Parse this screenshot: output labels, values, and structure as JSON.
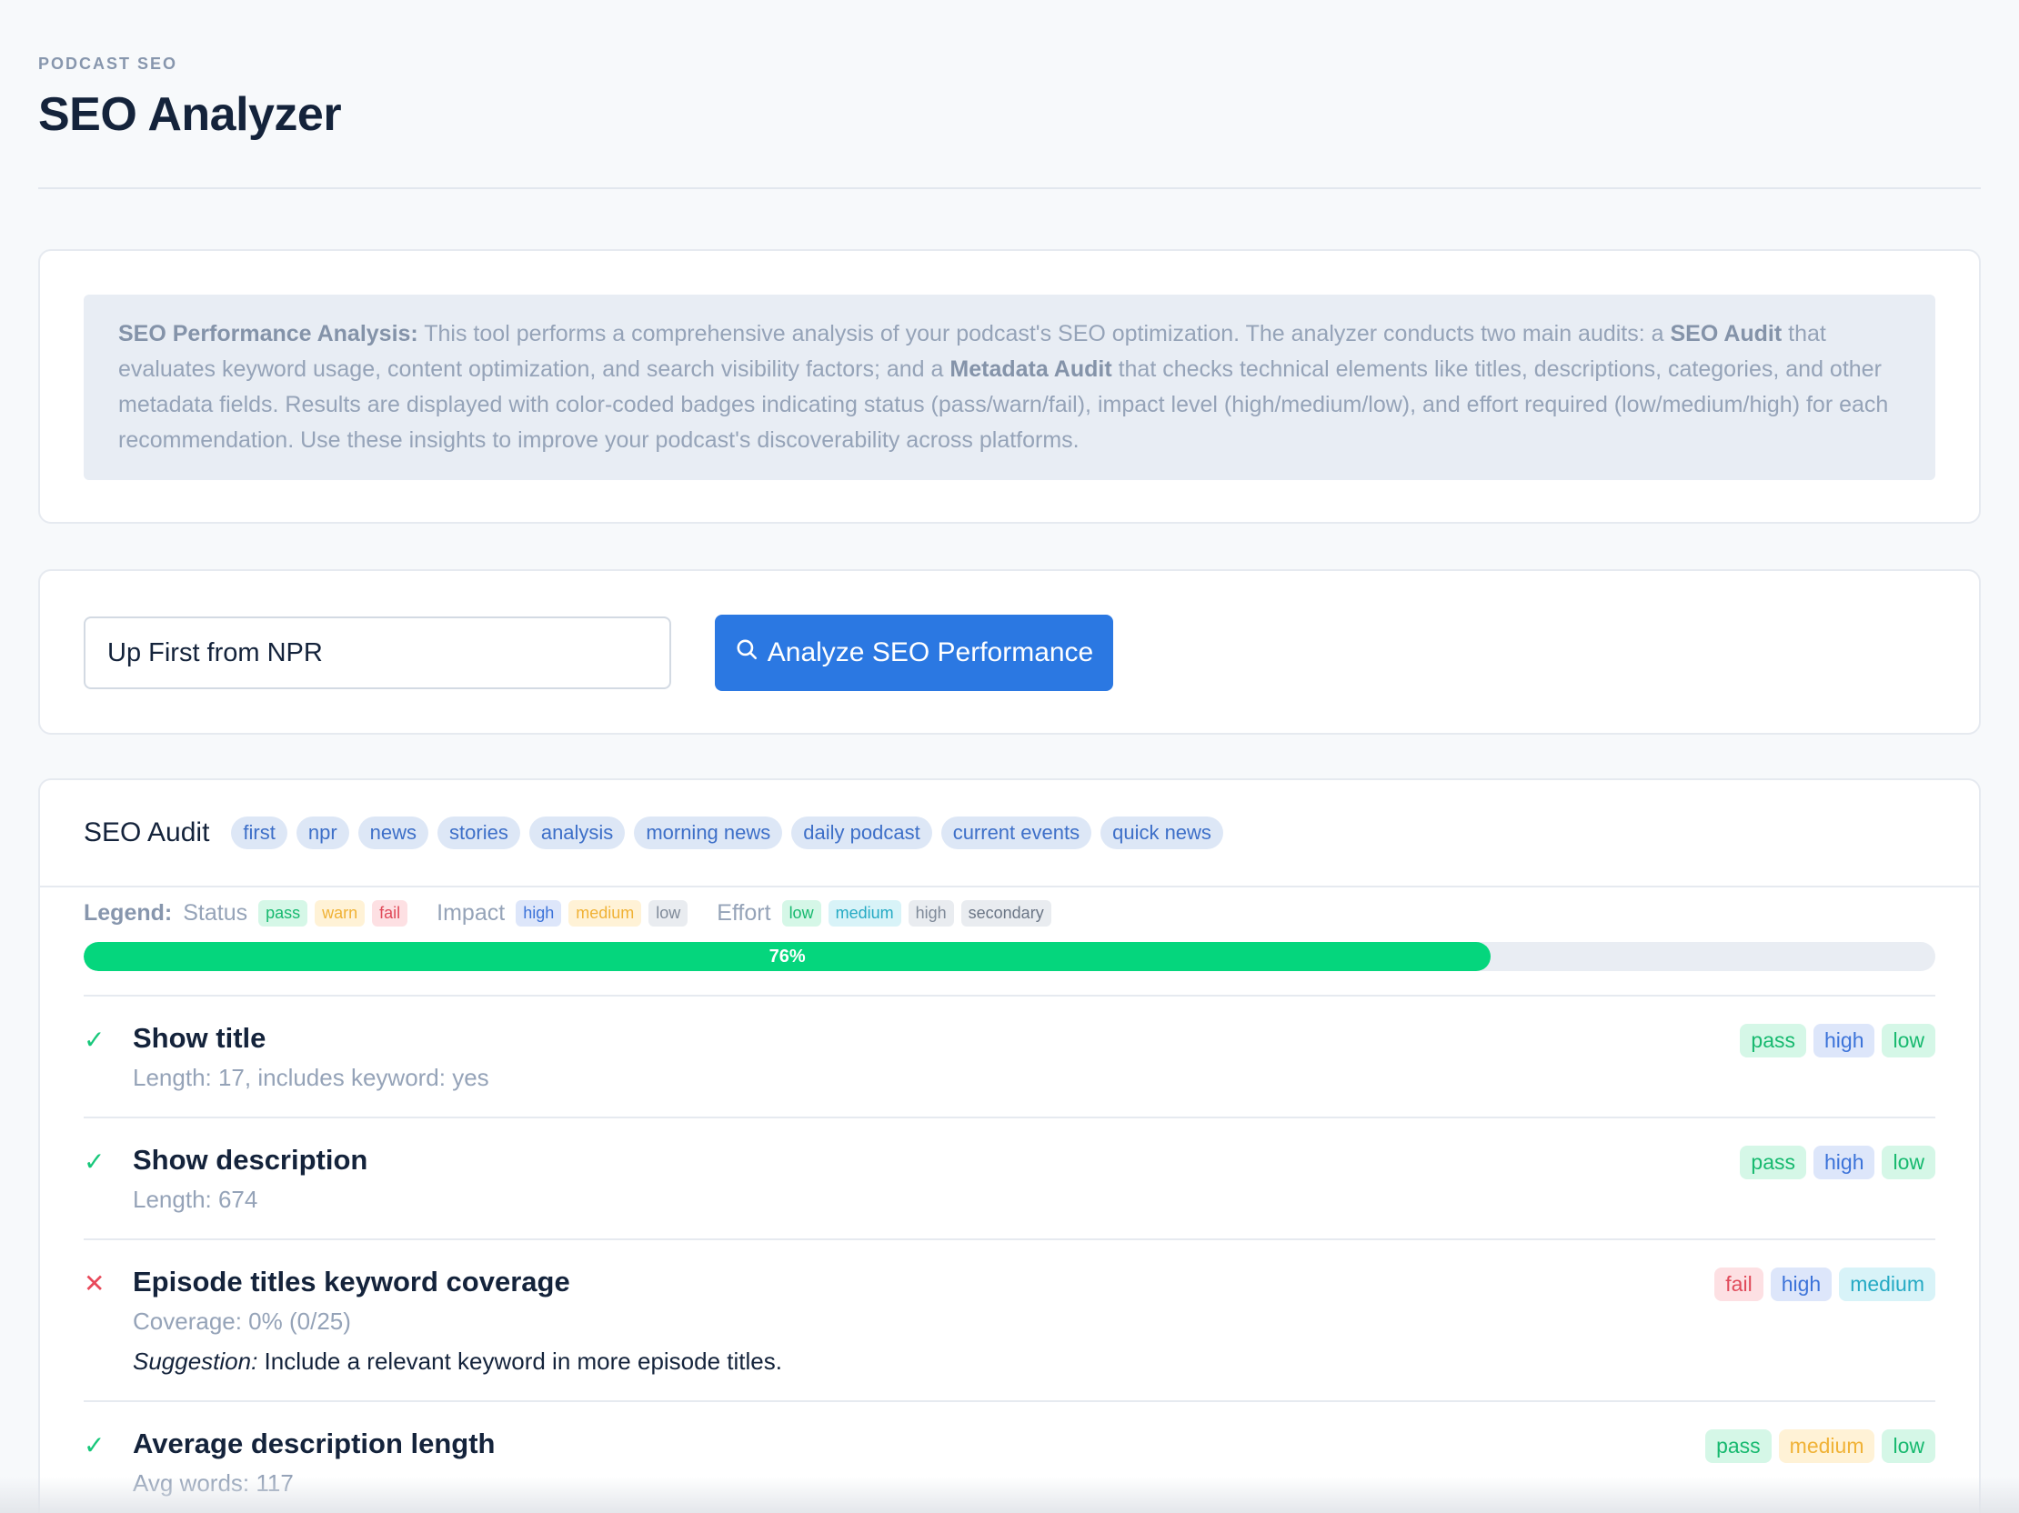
{
  "header": {
    "eyebrow": "PODCAST SEO",
    "title": "SEO Analyzer"
  },
  "info": {
    "lead": "SEO Performance Analysis:",
    "t1": " This tool performs a comprehensive analysis of your podcast's SEO optimization. The analyzer conducts two main audits: a ",
    "seo_audit": "SEO Audit",
    "t2": " that evaluates keyword usage, content optimization, and search visibility factors; and a ",
    "metadata_audit": "Metadata Audit",
    "t3": " that checks technical elements like titles, descriptions, categories, and other metadata fields. Results are displayed with color-coded badges indicating status (pass/warn/fail), impact level (high/medium/low), and effort required (low/medium/high) for each recommendation. Use these insights to improve your podcast's discoverability across platforms."
  },
  "search": {
    "value": "Up First from NPR",
    "button_label": "Analyze SEO Performance"
  },
  "audit": {
    "title": "SEO Audit",
    "keywords": [
      "first",
      "npr",
      "news",
      "stories",
      "analysis",
      "morning news",
      "daily podcast",
      "current events",
      "quick news"
    ],
    "legend": {
      "label": "Legend:",
      "status_label": "Status",
      "pass": "pass",
      "warn": "warn",
      "fail": "fail",
      "impact_label": "Impact",
      "high": "high",
      "medium": "medium",
      "low": "low",
      "effort_label": "Effort",
      "e_low": "low",
      "e_medium": "medium",
      "e_high": "high",
      "secondary": "secondary"
    },
    "progress": {
      "value": 76,
      "label": "76%"
    },
    "rows": [
      {
        "name": "Show title",
        "detail": "Length: 17, includes keyword: yes",
        "status": "pass",
        "impact": "high",
        "effort": "low"
      },
      {
        "name": "Show description",
        "detail": "Length: 674",
        "status": "pass",
        "impact": "high",
        "effort": "low"
      },
      {
        "name": "Episode titles keyword coverage",
        "detail": "Coverage: 0% (0/25)",
        "suggestion_label": "Suggestion:",
        "suggestion": " Include a relevant keyword in more episode titles.",
        "status": "fail",
        "impact": "high",
        "effort": "medium"
      },
      {
        "name": "Average description length",
        "detail": "Avg words: 117",
        "status": "pass",
        "impact": "medium",
        "effort": "low"
      }
    ]
  },
  "colors": {
    "accent": "#2b78e2",
    "progress": "#05d67d",
    "pass": "#17b96f",
    "fail": "#e04a5a"
  },
  "icons": {
    "search": "search-icon",
    "check": "check-icon",
    "cross": "cross-icon"
  }
}
